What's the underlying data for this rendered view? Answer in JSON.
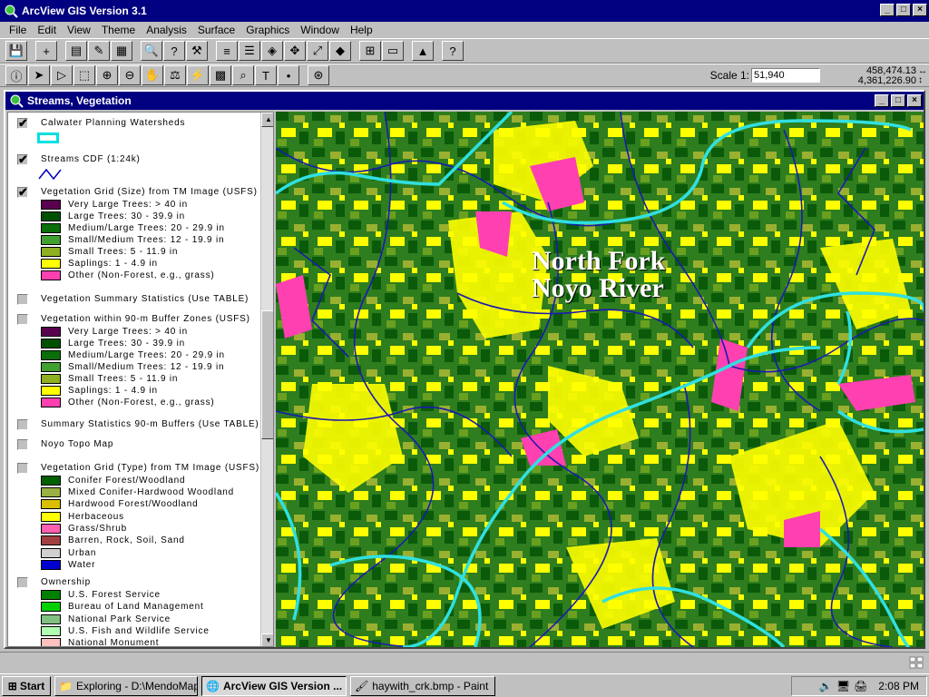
{
  "app": {
    "title": "ArcView GIS Version 3.1"
  },
  "menu": [
    "File",
    "Edit",
    "View",
    "Theme",
    "Analysis",
    "Surface",
    "Graphics",
    "Window",
    "Help"
  ],
  "toolbar": {
    "scale_label": "Scale 1:",
    "scale_value": "51,940",
    "coord_x": "458,474.13",
    "coord_y": "4,361,226.90"
  },
  "view": {
    "title": "Streams, Vegetation"
  },
  "legend": {
    "t1": {
      "name": "Calwater Planning Watersheds",
      "checked": true
    },
    "t2": {
      "name": "Streams CDF (1:24k)",
      "checked": true
    },
    "t3": {
      "name": "Vegetation Grid (Size) from TM Image (USFS)",
      "checked": true,
      "classes": [
        {
          "label": "Very Large Trees: > 40  in",
          "color": "#5a0050"
        },
        {
          "label": "Large Trees: 30 - 39.9 in",
          "color": "#005000"
        },
        {
          "label": "Medium/Large Trees: 20 - 29.9 in",
          "color": "#0a6e0a"
        },
        {
          "label": "Small/Medium Trees: 12 - 19.9 in",
          "color": "#40a030"
        },
        {
          "label": "Small Trees: 5 - 11.9 in",
          "color": "#8fb020"
        },
        {
          "label": "Saplings: 1 - 4.9 in",
          "color": "#ffff00"
        },
        {
          "label": "Other (Non-Forest, e.g., grass)",
          "color": "#ff40b0"
        }
      ]
    },
    "t4": {
      "name": "Vegetation Summary Statistics (Use TABLE)"
    },
    "t5": {
      "name": "Vegetation within 90-m Buffer Zones (USFS)",
      "classes": [
        {
          "label": "Very Large Trees: > 40  in",
          "color": "#5a0050"
        },
        {
          "label": "Large Trees: 30 - 39.9 in",
          "color": "#005000"
        },
        {
          "label": "Medium/Large Trees: 20 - 29.9 in",
          "color": "#0a6e0a"
        },
        {
          "label": "Small/Medium Trees: 12 - 19.9 in",
          "color": "#40a030"
        },
        {
          "label": "Small Trees: 5 - 11.9 in",
          "color": "#8fb020"
        },
        {
          "label": "Saplings: 1 - 4.9 in",
          "color": "#ffff00"
        },
        {
          "label": "Other (Non-Forest, e.g., grass)",
          "color": "#ff40b0"
        }
      ]
    },
    "t6": {
      "name": "Summary Statistics 90-m Buffers (Use TABLE)"
    },
    "t7": {
      "name": "Noyo Topo Map"
    },
    "t8": {
      "name": "Vegetation Grid (Type) from TM Image (USFS)",
      "classes": [
        {
          "label": "Conifer Forest/Woodland",
          "color": "#006000"
        },
        {
          "label": "Mixed Conifer-Hardwood Woodland",
          "color": "#9ab040"
        },
        {
          "label": "Hardwood Forest/Woodland",
          "color": "#d8c000"
        },
        {
          "label": "Herbaceous",
          "color": "#ffff00"
        },
        {
          "label": "Grass/Shrub",
          "color": "#ff60b0"
        },
        {
          "label": "Barren, Rock, Soil, Sand",
          "color": "#a04040"
        },
        {
          "label": "Urban",
          "color": "#d0d0d0"
        },
        {
          "label": "Water",
          "color": "#0000d0"
        }
      ]
    },
    "t9": {
      "name": "Ownership",
      "classes": [
        {
          "label": "U.S. Forest Service",
          "color": "#008000"
        },
        {
          "label": "Bureau of Land Management",
          "color": "#00d000"
        },
        {
          "label": "National Park Service",
          "color": "#80c080"
        },
        {
          "label": "U.S. Fish and Wildlife Service",
          "color": "#b0ffb0"
        },
        {
          "label": "National Monument",
          "color": "#ffc0c0"
        }
      ]
    }
  },
  "map": {
    "label_line1": "North Fork",
    "label_line2": "Noyo River"
  },
  "taskbar": {
    "start": "Start",
    "tasks": [
      "Exploring - D:\\MendoMaps",
      "ArcView GIS Version ...",
      "haywith_crk.bmp - Paint"
    ],
    "clock": "2:08 PM"
  }
}
